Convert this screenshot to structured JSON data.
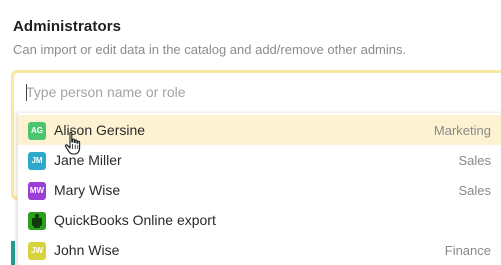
{
  "section": {
    "title": "Administrators",
    "description": "Can import or edit data in the catalog and add/remove other admins."
  },
  "search": {
    "placeholder": "Type person name or role",
    "value": ""
  },
  "options": [
    {
      "initials": "AG",
      "name": "Alison Gersine",
      "role": "Marketing",
      "color": "#4bc66f",
      "highlighted": true
    },
    {
      "initials": "JM",
      "name": "Jane Miller",
      "role": "Sales",
      "color": "#2da9c9",
      "highlighted": false
    },
    {
      "initials": "MW",
      "name": "Mary Wise",
      "role": "Sales",
      "color": "#9b3fd6",
      "highlighted": false
    },
    {
      "initials": "",
      "name": "QuickBooks Online export",
      "role": "",
      "color": "#2ca01c",
      "icon": "quickbooks-icon",
      "highlighted": false
    },
    {
      "initials": "JW",
      "name": "John Wise",
      "role": "Finance",
      "color": "#d8d23c",
      "highlighted": false
    }
  ],
  "colors": {
    "focus_frame": "#fbe7a1",
    "highlight_row": "#fdf3d2",
    "accent": "#1e9e8b"
  },
  "cursor": "hand-pointer-icon"
}
